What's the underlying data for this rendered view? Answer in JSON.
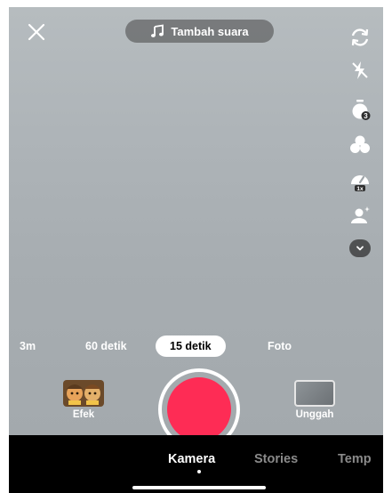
{
  "top": {
    "sound_label": "Tambah suara"
  },
  "tools": [
    {
      "name": "flip-camera-icon"
    },
    {
      "name": "flash-off-icon"
    },
    {
      "name": "timer-icon",
      "badge": "3"
    },
    {
      "name": "filters-icon"
    },
    {
      "name": "speed-icon",
      "badge": "1x"
    },
    {
      "name": "beauty-icon"
    },
    {
      "name": "more-options-icon"
    }
  ],
  "durations": [
    {
      "label": "3m",
      "selected": false
    },
    {
      "label": "60 detik",
      "selected": false
    },
    {
      "label": "15 detik",
      "selected": true
    },
    {
      "label": "Foto",
      "selected": false
    }
  ],
  "controls": {
    "effects_label": "Efek",
    "upload_label": "Unggah"
  },
  "nav": {
    "tabs": [
      {
        "label": "Kamera",
        "active": true
      },
      {
        "label": "Stories",
        "active": false
      },
      {
        "label": "Temp",
        "active": false
      }
    ]
  },
  "colors": {
    "record": "#fe2c55",
    "inactive_tab": "#8a8a8a",
    "active_tab": "#ffffff"
  }
}
